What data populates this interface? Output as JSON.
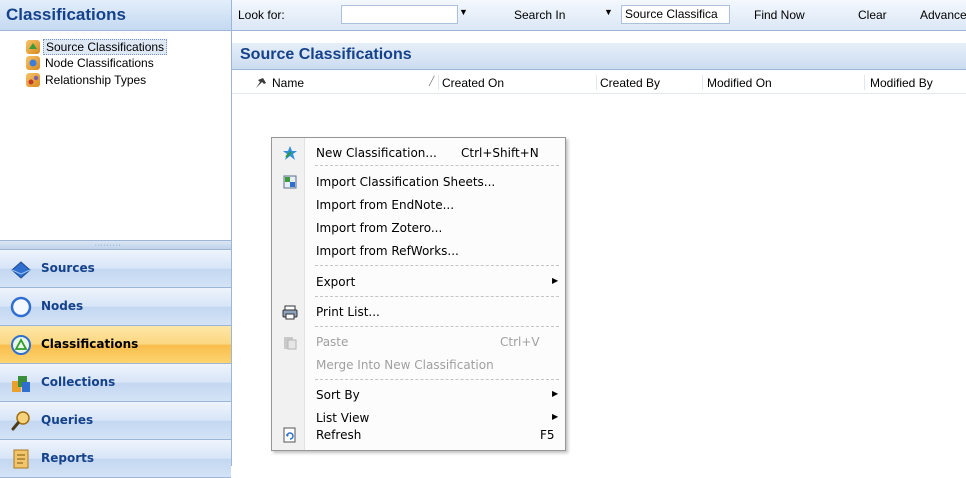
{
  "left_pane": {
    "title": "Classifications",
    "tree": [
      {
        "label": "Source Classifications",
        "selected": true
      },
      {
        "label": "Node Classifications"
      },
      {
        "label": "Relationship Types"
      }
    ],
    "splitter_grip": "∙∙∙∙∙∙∙∙∙",
    "nav_buttons": [
      {
        "label": "Sources",
        "icon": "sources-icon"
      },
      {
        "label": "Nodes",
        "icon": "nodes-icon"
      },
      {
        "label": "Classifications",
        "icon": "classifications-icon",
        "active": true
      },
      {
        "label": "Collections",
        "icon": "collections-icon"
      },
      {
        "label": "Queries",
        "icon": "queries-icon"
      },
      {
        "label": "Reports",
        "icon": "reports-icon"
      }
    ]
  },
  "toolbar": {
    "look_for_label": "Look for:",
    "look_for_value": "",
    "search_in_label": "Search In",
    "search_in_value": "Source Classifica",
    "find_now_label": "Find Now",
    "clear_label": "Clear",
    "advanced_label": "Advance"
  },
  "content": {
    "title": "Source Classifications",
    "columns": [
      "Name",
      "Created On",
      "Created By",
      "Modified On",
      "Modified By"
    ]
  },
  "context_menu": {
    "items": [
      {
        "label": "New Classification...",
        "shortcut": "Ctrl+Shift+N",
        "icon": "new-classification-icon"
      },
      {
        "label": "Import Classification Sheets...",
        "icon": "import-sheets-icon"
      },
      {
        "label": "Import from EndNote..."
      },
      {
        "label": "Import from Zotero..."
      },
      {
        "label": "Import from RefWorks..."
      },
      {
        "label": "Export",
        "submenu": true
      },
      {
        "label": "Print List...",
        "icon": "print-icon"
      },
      {
        "label": "Paste",
        "shortcut": "Ctrl+V",
        "disabled": true,
        "icon": "paste-icon"
      },
      {
        "label": "Merge Into New Classification",
        "disabled": true
      },
      {
        "label": "Sort By",
        "submenu": true
      },
      {
        "label": "List View",
        "submenu": true
      },
      {
        "label": "Refresh",
        "shortcut": "F5",
        "icon": "refresh-icon"
      }
    ]
  },
  "colors": {
    "header_text": "#15428b",
    "active_nav": "#f9bd4b",
    "pane_border": "#9eb6d6"
  }
}
